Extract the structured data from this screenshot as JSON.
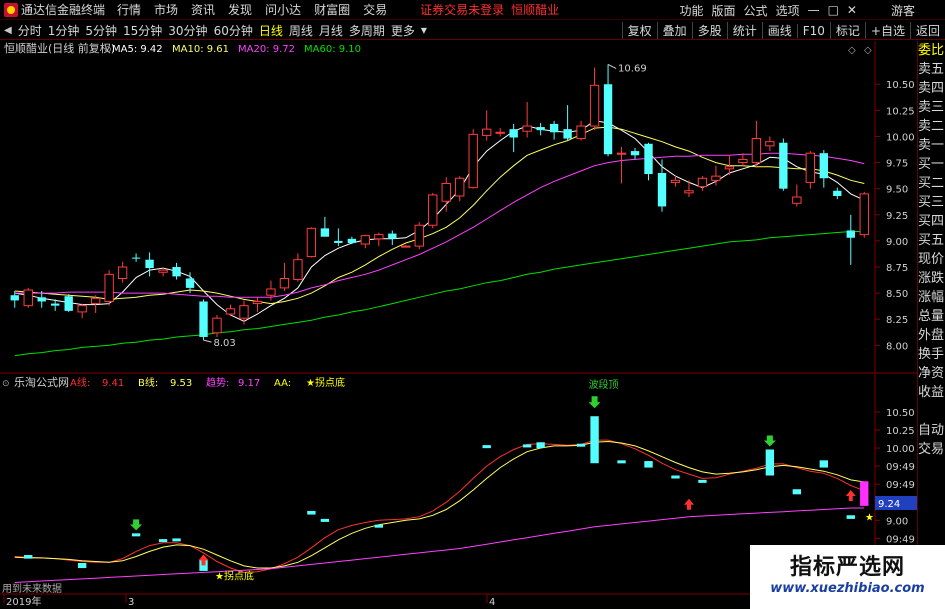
{
  "menubar": {
    "app_title": "通达信金融终端",
    "items": [
      "行情",
      "市场",
      "资讯",
      "发现",
      "问小达",
      "财富圈",
      "交易"
    ],
    "notice": "证券交易未登录",
    "stock_name": "恒顺醋业",
    "right_items": [
      "功能",
      "版面",
      "公式",
      "选项"
    ],
    "guest": "游客",
    "window_buttons": [
      "—",
      "□",
      "✕"
    ]
  },
  "periods": {
    "items": [
      "分时",
      "1分钟",
      "5分钟",
      "15分钟",
      "30分钟",
      "60分钟",
      "日线",
      "周线",
      "月线",
      "多周期",
      "更多"
    ],
    "active": "日线"
  },
  "toolbar_right": [
    "复权",
    "叠加",
    "多股",
    "统计",
    "画线",
    "F10",
    "标记",
    "+自选",
    "返回"
  ],
  "sidepanel": {
    "items": [
      "委比",
      "卖五",
      "卖四",
      "卖三",
      "卖二",
      "卖一",
      "买一",
      "买二",
      "买三",
      "买四",
      "买五",
      "现价",
      "涨跌",
      "涨幅",
      "总量",
      "外盘",
      "换手",
      "净资",
      "收益",
      "",
      "自动",
      "交易"
    ]
  },
  "main_panel": {
    "title": "恒顺醋业(日线 前复权)",
    "legend": [
      {
        "label": "MA5: 9.42",
        "color": "#ffffff"
      },
      {
        "label": "MA10: 9.61",
        "color": "#ffff60"
      },
      {
        "label": "MA20: 9.72",
        "color": "#ff40ff"
      },
      {
        "label": "MA60: 9.10",
        "color": "#00e000"
      }
    ],
    "high_label": "10.69",
    "low_label": "8.03",
    "yticks": [
      "10.50",
      "10.25",
      "10.00",
      "9.75",
      "9.50",
      "9.25",
      "9.00",
      "8.75",
      "8.50",
      "8.25",
      "8.00"
    ]
  },
  "sub_panel": {
    "title": "乐淘公式网",
    "legend": [
      {
        "label": "A线:",
        "value": "9.41",
        "color": "#ff3030"
      },
      {
        "label": "B线:",
        "value": "9.53",
        "color": "#ffff60"
      },
      {
        "label": "趋势:",
        "value": "9.17",
        "color": "#ff40ff"
      },
      {
        "label": "AA:",
        "value": "★拐点底",
        "color": "#ffff00"
      }
    ],
    "top_annotation": "波段顶",
    "bottom_annotation": "★拐点底",
    "price_tag": "9.24",
    "yticks": [
      "10.50",
      "10.25",
      "10.00",
      "09:49",
      "09:49",
      "09:49",
      "9.00",
      "09:49",
      "09:49",
      "09:49"
    ],
    "footer": "用到未来数据"
  },
  "xaxis": {
    "labels": [
      "2019年",
      "3",
      "4"
    ]
  },
  "watermark": {
    "line1": "指标严选网",
    "line2": "www.xuezhibiao.com"
  },
  "chart_data": {
    "type": "candlestick",
    "title": "恒顺醋业(日线 前复权)",
    "ylim": [
      7.85,
      10.78
    ],
    "candles": [
      {
        "o": 8.48,
        "h": 8.52,
        "l": 8.36,
        "c": 8.43
      },
      {
        "o": 8.38,
        "h": 8.55,
        "l": 8.36,
        "c": 8.53
      },
      {
        "o": 8.46,
        "h": 8.52,
        "l": 8.36,
        "c": 8.42
      },
      {
        "o": 8.4,
        "h": 8.44,
        "l": 8.33,
        "c": 8.38
      },
      {
        "o": 8.47,
        "h": 8.49,
        "l": 8.32,
        "c": 8.33
      },
      {
        "o": 8.32,
        "h": 8.4,
        "l": 8.26,
        "c": 8.38
      },
      {
        "o": 8.4,
        "h": 8.48,
        "l": 8.31,
        "c": 8.45
      },
      {
        "o": 8.42,
        "h": 8.72,
        "l": 8.38,
        "c": 8.68
      },
      {
        "o": 8.64,
        "h": 8.8,
        "l": 8.6,
        "c": 8.75
      },
      {
        "o": 8.84,
        "h": 8.88,
        "l": 8.8,
        "c": 8.83
      },
      {
        "o": 8.82,
        "h": 8.89,
        "l": 8.66,
        "c": 8.74
      },
      {
        "o": 8.7,
        "h": 8.74,
        "l": 8.66,
        "c": 8.72
      },
      {
        "o": 8.75,
        "h": 8.79,
        "l": 8.63,
        "c": 8.66
      },
      {
        "o": 8.64,
        "h": 8.7,
        "l": 8.5,
        "c": 8.55
      },
      {
        "o": 8.42,
        "h": 8.44,
        "l": 8.05,
        "c": 8.08
      },
      {
        "o": 8.12,
        "h": 8.29,
        "l": 8.08,
        "c": 8.26
      },
      {
        "o": 8.3,
        "h": 8.39,
        "l": 8.28,
        "c": 8.35
      },
      {
        "o": 8.26,
        "h": 8.43,
        "l": 8.2,
        "c": 8.38
      },
      {
        "o": 8.4,
        "h": 8.46,
        "l": 8.32,
        "c": 8.42
      },
      {
        "o": 8.48,
        "h": 8.62,
        "l": 8.43,
        "c": 8.54
      },
      {
        "o": 8.55,
        "h": 8.79,
        "l": 8.52,
        "c": 8.64
      },
      {
        "o": 8.63,
        "h": 8.88,
        "l": 8.61,
        "c": 8.82
      },
      {
        "o": 8.85,
        "h": 9.13,
        "l": 8.84,
        "c": 9.12
      },
      {
        "o": 9.12,
        "h": 9.23,
        "l": 9.08,
        "c": 9.04
      },
      {
        "o": 9.0,
        "h": 9.12,
        "l": 8.95,
        "c": 8.98
      },
      {
        "o": 9.02,
        "h": 9.04,
        "l": 8.97,
        "c": 8.98
      },
      {
        "o": 8.97,
        "h": 9.06,
        "l": 8.93,
        "c": 9.05
      },
      {
        "o": 9.02,
        "h": 9.08,
        "l": 8.95,
        "c": 9.06
      },
      {
        "o": 9.07,
        "h": 9.1,
        "l": 8.96,
        "c": 9.02
      },
      {
        "o": 8.95,
        "h": 8.96,
        "l": 8.94,
        "c": 8.95
      },
      {
        "o": 8.95,
        "h": 9.18,
        "l": 8.92,
        "c": 9.15
      },
      {
        "o": 9.15,
        "h": 9.46,
        "l": 9.12,
        "c": 9.44
      },
      {
        "o": 9.38,
        "h": 9.61,
        "l": 9.28,
        "c": 9.55
      },
      {
        "o": 9.43,
        "h": 9.62,
        "l": 9.38,
        "c": 9.6
      },
      {
        "o": 9.51,
        "h": 10.07,
        "l": 9.5,
        "c": 10.02
      },
      {
        "o": 10.01,
        "h": 10.25,
        "l": 9.96,
        "c": 10.07
      },
      {
        "o": 10.03,
        "h": 10.08,
        "l": 10.0,
        "c": 10.04
      },
      {
        "o": 10.07,
        "h": 10.12,
        "l": 9.85,
        "c": 9.99
      },
      {
        "o": 10.05,
        "h": 10.33,
        "l": 9.99,
        "c": 10.1
      },
      {
        "o": 10.09,
        "h": 10.13,
        "l": 10.01,
        "c": 10.06
      },
      {
        "o": 10.12,
        "h": 10.15,
        "l": 9.97,
        "c": 10.04
      },
      {
        "o": 10.07,
        "h": 10.3,
        "l": 9.96,
        "c": 9.98
      },
      {
        "o": 9.98,
        "h": 10.15,
        "l": 9.96,
        "c": 10.1
      },
      {
        "o": 10.1,
        "h": 10.66,
        "l": 10.06,
        "c": 10.49
      },
      {
        "o": 10.5,
        "h": 10.69,
        "l": 9.81,
        "c": 9.83
      },
      {
        "o": 9.83,
        "h": 9.9,
        "l": 9.55,
        "c": 9.84
      },
      {
        "o": 9.86,
        "h": 9.89,
        "l": 9.78,
        "c": 9.82
      },
      {
        "o": 9.93,
        "h": 9.94,
        "l": 9.58,
        "c": 9.64
      },
      {
        "o": 9.65,
        "h": 9.78,
        "l": 9.28,
        "c": 9.33
      },
      {
        "o": 9.56,
        "h": 9.63,
        "l": 9.52,
        "c": 9.58
      },
      {
        "o": 9.46,
        "h": 9.58,
        "l": 9.42,
        "c": 9.48
      },
      {
        "o": 9.52,
        "h": 9.62,
        "l": 9.48,
        "c": 9.6
      },
      {
        "o": 9.58,
        "h": 9.72,
        "l": 9.53,
        "c": 9.62
      },
      {
        "o": 9.69,
        "h": 9.82,
        "l": 9.63,
        "c": 9.71
      },
      {
        "o": 9.75,
        "h": 9.84,
        "l": 9.71,
        "c": 9.78
      },
      {
        "o": 9.75,
        "h": 10.15,
        "l": 9.7,
        "c": 9.98
      },
      {
        "o": 9.91,
        "h": 10.0,
        "l": 9.86,
        "c": 9.95
      },
      {
        "o": 9.94,
        "h": 9.98,
        "l": 9.48,
        "c": 9.5
      },
      {
        "o": 9.36,
        "h": 9.54,
        "l": 9.33,
        "c": 9.42
      },
      {
        "o": 9.56,
        "h": 9.86,
        "l": 9.5,
        "c": 9.84
      },
      {
        "o": 9.84,
        "h": 9.87,
        "l": 9.51,
        "c": 9.6
      },
      {
        "o": 9.48,
        "h": 9.51,
        "l": 9.4,
        "c": 9.43
      },
      {
        "o": 9.1,
        "h": 9.25,
        "l": 8.77,
        "c": 9.03
      },
      {
        "o": 9.06,
        "h": 9.47,
        "l": 9.03,
        "c": 9.45
      }
    ],
    "ma": [
      {
        "name": "MA5",
        "color": "#ffffff",
        "values": [
          8.5,
          8.48,
          8.45,
          8.43,
          8.41,
          8.39,
          8.39,
          8.4,
          8.51,
          8.65,
          8.72,
          8.74,
          8.71,
          8.66,
          8.52,
          8.39,
          8.29,
          8.23,
          8.3,
          8.38,
          8.45,
          8.55,
          8.75,
          8.86,
          8.93,
          8.98,
          9.01,
          9.02,
          9.02,
          9.03,
          9.1,
          9.21,
          9.35,
          9.49,
          9.71,
          9.86,
          9.96,
          10.05,
          10.1,
          10.07,
          10.05,
          10.04,
          10.06,
          10.15,
          10.13,
          10.06,
          9.98,
          9.85,
          9.71,
          9.62,
          9.56,
          9.51,
          9.57,
          9.65,
          9.69,
          9.73,
          9.8,
          9.79,
          9.71,
          9.66,
          9.64,
          9.56,
          9.45,
          9.39
        ]
      },
      {
        "name": "MA10",
        "color": "#ffff60",
        "values": [
          8.52,
          8.51,
          8.5,
          8.49,
          8.48,
          8.47,
          8.46,
          8.44,
          8.45,
          8.46,
          8.48,
          8.49,
          8.51,
          8.53,
          8.52,
          8.5,
          8.47,
          8.44,
          8.42,
          8.4,
          8.42,
          8.45,
          8.5,
          8.57,
          8.65,
          8.7,
          8.77,
          8.85,
          8.92,
          8.98,
          9.02,
          9.07,
          9.13,
          9.22,
          9.34,
          9.48,
          9.61,
          9.72,
          9.82,
          9.87,
          9.92,
          9.96,
          10.02,
          10.08,
          10.09,
          10.07,
          10.03,
          9.99,
          9.95,
          9.9,
          9.86,
          9.8,
          9.75,
          9.72,
          9.72,
          9.71,
          9.71,
          9.7,
          9.69,
          9.69,
          9.67,
          9.63,
          9.58,
          9.55
        ]
      },
      {
        "name": "MA20",
        "color": "#ff40ff",
        "values": [
          8.5,
          8.5,
          8.5,
          8.5,
          8.51,
          8.51,
          8.51,
          8.51,
          8.5,
          8.5,
          8.5,
          8.5,
          8.49,
          8.48,
          8.47,
          8.47,
          8.46,
          8.46,
          8.46,
          8.46,
          8.48,
          8.51,
          8.55,
          8.58,
          8.62,
          8.65,
          8.68,
          8.72,
          8.77,
          8.82,
          8.87,
          8.93,
          8.99,
          9.06,
          9.13,
          9.21,
          9.29,
          9.37,
          9.44,
          9.51,
          9.57,
          9.62,
          9.67,
          9.72,
          9.75,
          9.77,
          9.78,
          9.79,
          9.8,
          9.81,
          9.81,
          9.82,
          9.82,
          9.82,
          9.83,
          9.83,
          9.84,
          9.84,
          9.83,
          9.82,
          9.81,
          9.79,
          9.77,
          9.74
        ]
      },
      {
        "name": "MA60",
        "color": "#00e000",
        "values": [
          7.9,
          7.92,
          7.93,
          7.95,
          7.96,
          7.98,
          7.99,
          8.0,
          8.02,
          8.03,
          8.05,
          8.06,
          8.08,
          8.09,
          8.1,
          8.12,
          8.13,
          8.15,
          8.16,
          8.18,
          8.2,
          8.22,
          8.24,
          8.27,
          8.29,
          8.32,
          8.34,
          8.37,
          8.4,
          8.43,
          8.46,
          8.49,
          8.52,
          8.54,
          8.57,
          8.6,
          8.62,
          8.65,
          8.68,
          8.7,
          8.73,
          8.75,
          8.77,
          8.79,
          8.81,
          8.83,
          8.85,
          8.87,
          8.89,
          8.91,
          8.93,
          8.95,
          8.97,
          8.99,
          9.0,
          9.01,
          9.03,
          9.04,
          9.05,
          9.06,
          9.07,
          9.08,
          9.09,
          9.09
        ]
      }
    ]
  },
  "sub_chart": {
    "type": "indicator",
    "series": [
      {
        "name": "A线",
        "color": "#ff3030",
        "values": [
          8.5,
          8.49,
          8.48,
          8.47,
          8.45,
          8.43,
          8.42,
          8.42,
          8.47,
          8.57,
          8.65,
          8.69,
          8.69,
          8.65,
          8.55,
          8.43,
          8.34,
          8.28,
          8.29,
          8.33,
          8.4,
          8.49,
          8.62,
          8.76,
          8.87,
          8.93,
          8.97,
          9.0,
          9.01,
          9.02,
          9.05,
          9.13,
          9.25,
          9.4,
          9.58,
          9.75,
          9.88,
          9.98,
          10.05,
          10.06,
          10.05,
          10.04,
          10.05,
          10.11,
          10.11,
          10.06,
          9.99,
          9.9,
          9.79,
          9.7,
          9.64,
          9.58,
          9.59,
          9.64,
          9.68,
          9.72,
          9.78,
          9.78,
          9.73,
          9.68,
          9.65,
          9.58,
          9.48,
          9.41
        ]
      },
      {
        "name": "B线",
        "color": "#ffff60",
        "values": [
          8.49,
          8.48,
          8.48,
          8.47,
          8.46,
          8.44,
          8.43,
          8.42,
          8.44,
          8.5,
          8.57,
          8.63,
          8.66,
          8.65,
          8.6,
          8.52,
          8.44,
          8.37,
          8.34,
          8.34,
          8.37,
          8.42,
          8.51,
          8.62,
          8.73,
          8.82,
          8.89,
          8.94,
          8.97,
          9.0,
          9.02,
          9.07,
          9.15,
          9.27,
          9.42,
          9.58,
          9.73,
          9.85,
          9.95,
          10.0,
          10.03,
          10.03,
          10.04,
          10.08,
          10.09,
          10.07,
          10.03,
          9.96,
          9.88,
          9.8,
          9.73,
          9.67,
          9.64,
          9.65,
          9.67,
          9.7,
          9.74,
          9.76,
          9.74,
          9.71,
          9.68,
          9.63,
          9.56,
          9.53
        ]
      },
      {
        "name": "趋势",
        "color": "#ff40ff",
        "values": [
          8.14,
          8.15,
          8.16,
          8.17,
          8.18,
          8.19,
          8.2,
          8.21,
          8.22,
          8.23,
          8.24,
          8.25,
          8.26,
          8.27,
          8.28,
          8.29,
          8.3,
          8.31,
          8.32,
          8.33,
          8.35,
          8.37,
          8.39,
          8.41,
          8.43,
          8.45,
          8.47,
          8.49,
          8.51,
          8.53,
          8.55,
          8.57,
          8.59,
          8.61,
          8.64,
          8.67,
          8.7,
          8.73,
          8.76,
          8.79,
          8.82,
          8.85,
          8.88,
          8.91,
          8.93,
          8.95,
          8.97,
          8.99,
          9.01,
          9.03,
          9.05,
          9.06,
          9.07,
          9.08,
          9.09,
          9.1,
          9.11,
          9.12,
          9.13,
          9.14,
          9.15,
          9.16,
          9.17,
          9.17
        ]
      }
    ],
    "blocks": [
      {
        "i": 1,
        "top": 8.52,
        "bot": 8.47
      },
      {
        "i": 5,
        "top": 8.41,
        "bot": 8.34
      },
      {
        "i": 9,
        "top": 8.82,
        "bot": 8.78
      },
      {
        "i": 11,
        "top": 8.74,
        "bot": 8.7
      },
      {
        "i": 12,
        "top": 8.75,
        "bot": 8.71
      },
      {
        "i": 14,
        "top": 8.45,
        "bot": 8.3
      },
      {
        "i": 22,
        "top": 9.13,
        "bot": 9.08
      },
      {
        "i": 23,
        "top": 9.02,
        "bot": 8.98
      },
      {
        "i": 27,
        "top": 8.94,
        "bot": 8.93
      },
      {
        "i": 35,
        "top": 10.04,
        "bot": 10.02
      },
      {
        "i": 38,
        "top": 10.05,
        "bot": 10.01
      },
      {
        "i": 39,
        "top": 10.08,
        "bot": 10.0
      },
      {
        "i": 42,
        "top": 10.06,
        "bot": 10.04
      },
      {
        "i": 43,
        "top": 10.44,
        "bot": 9.79
      },
      {
        "i": 45,
        "top": 9.83,
        "bot": 9.8
      },
      {
        "i": 47,
        "top": 9.82,
        "bot": 9.73
      },
      {
        "i": 49,
        "top": 9.62,
        "bot": 9.59
      },
      {
        "i": 51,
        "top": 9.56,
        "bot": 9.55
      },
      {
        "i": 56,
        "top": 9.98,
        "bot": 9.62
      },
      {
        "i": 58,
        "top": 9.43,
        "bot": 9.36
      },
      {
        "i": 60,
        "top": 9.83,
        "bot": 9.73
      },
      {
        "i": 62,
        "top": 9.07,
        "bot": 9.02
      }
    ],
    "green_arrows": [
      9,
      56
    ],
    "red_arrows": [
      14,
      50,
      62
    ],
    "pink_block": {
      "i": 63,
      "top": 9.54,
      "bot": 9.2
    }
  }
}
